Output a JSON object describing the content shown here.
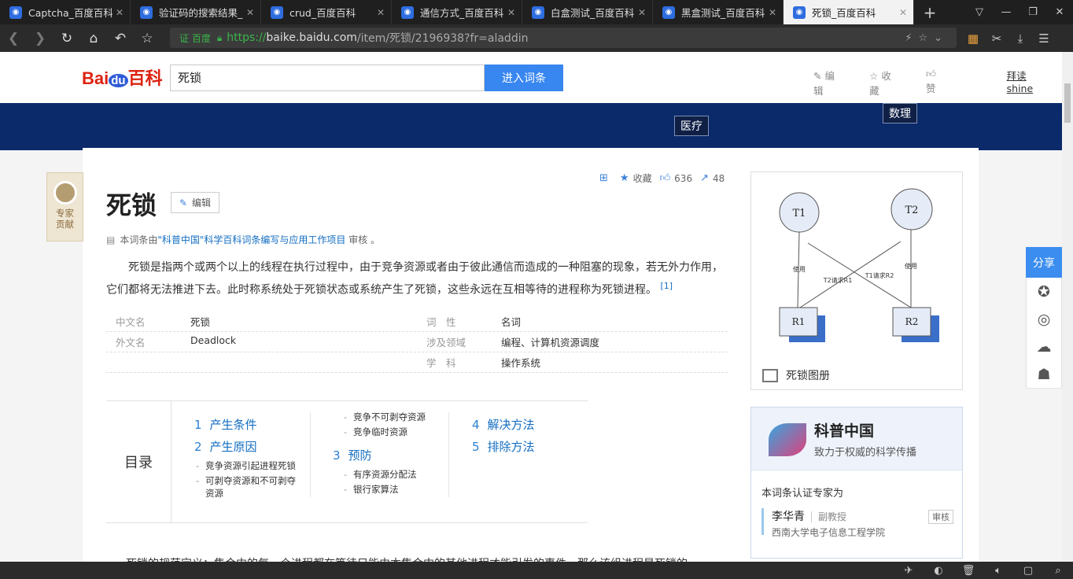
{
  "browser": {
    "tabs": [
      {
        "title": "Captcha_百度百科",
        "active": false
      },
      {
        "title": "验证码的搜索结果_百",
        "active": false
      },
      {
        "title": "crud_百度百科",
        "active": false
      },
      {
        "title": "通信方式_百度百科",
        "active": false
      },
      {
        "title": "白盒测试_百度百科",
        "active": false
      },
      {
        "title": "黑盒测试_百度百科",
        "active": false
      },
      {
        "title": "死锁_百度百科",
        "active": true
      }
    ],
    "cert_label": "证 百度",
    "url_proto": "https://",
    "url_host": "baike.baidu.com",
    "url_rest": "/item/死锁/2196938?fr=aladdin"
  },
  "site": {
    "logo_a": "Bai",
    "logo_du": "du",
    "logo_b": "百科",
    "search_value": "死锁",
    "search_button": "进入词条",
    "edit_link": "编辑",
    "fav_link": "收藏",
    "like_link": "赞",
    "user": "拜读shine"
  },
  "banner": {
    "tag1": "医疗",
    "tag2": "数理"
  },
  "expert": {
    "line1": "专家",
    "line2": "贡献"
  },
  "article": {
    "title": "死锁",
    "edit": "编辑",
    "fav": "收藏",
    "likes": "636",
    "shares": "48",
    "review_prefix": "本词条由",
    "review_link": "\"科普中国\"科学百科词条编写与应用工作项目",
    "review_suffix": " 审核 。",
    "summary": "死锁是指两个或两个以上的线程在执行过程中，由于竞争资源或者由于彼此通信而造成的一种阻塞的现象，若无外力作用，它们都将无法推进下去。此时称系统处于死锁状态或系统产生了死锁，这些永远在互相等待的进程称为死锁进程。",
    "summary_ref": "[1]",
    "basic_info": [
      [
        {
          "name": "中文名",
          "value": "死锁"
        },
        {
          "name": "词　性",
          "value": "名词"
        }
      ],
      [
        {
          "name": "外文名",
          "value": "Deadlock"
        },
        {
          "name": "涉及领域",
          "value": "编程、计算机资源调度"
        }
      ],
      [
        {
          "name": "",
          "value": ""
        },
        {
          "name": "学　科",
          "value": "操作系统"
        }
      ]
    ],
    "toc_label": "目录",
    "toc": {
      "c1": "产生条件",
      "c2": "产生原因",
      "c2a": "竞争资源引起进程死锁",
      "c2b": "可剥夺资源和不可剥夺资源",
      "c2c": "竞争不可剥夺资源",
      "c2d": "竞争临时资源",
      "c3": "预防",
      "c3a": "有序资源分配法",
      "c3b": "银行家算法",
      "c4": "解决方法",
      "c5": "排除方法"
    },
    "cut_text": "死锁的规范定义：集合中的每一个进程都在等待只能由本集合中的其他进程才能引发的事件，那么该组进程是死锁的。"
  },
  "album": {
    "caption": "死锁图册",
    "nodes": {
      "t1": "T1",
      "t2": "T2",
      "r1": "R1",
      "r2": "R2"
    },
    "edges": {
      "use1": "使用",
      "use2": "使用",
      "t2req": "T2请求R1",
      "t1req": "T1请求R2"
    }
  },
  "kepu": {
    "name": "科普中国",
    "slogan": "致力于权威的科学传播",
    "cert_by": "本词条认证专家为",
    "expert_name": "李华青",
    "expert_title": "副教授",
    "expert_org": "西南大学电子信息工程学院",
    "badge": "审核"
  },
  "share": {
    "label": "分享"
  }
}
